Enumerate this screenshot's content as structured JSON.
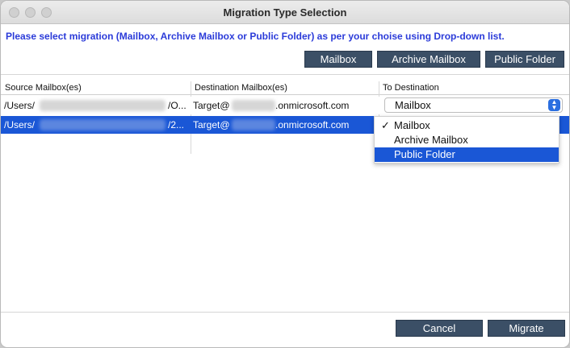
{
  "window": {
    "title": "Migration Type Selection"
  },
  "instruction": "Please select migration (Mailbox, Archive Mailbox or Public Folder) as per your choise using Drop-down list.",
  "toolbar": {
    "mailbox": "Mailbox",
    "archive_mailbox": "Archive Mailbox",
    "public_folder": "Public Folder"
  },
  "table": {
    "columns": [
      "Source Mailbox(es)",
      "Destination Mailbox(es)",
      "To Destination"
    ],
    "rows": [
      {
        "source_start": "/Users/",
        "source_end": "/O...",
        "dest_start": "Target@",
        "dest_end": ".onmicrosoft.com",
        "to": "Mailbox"
      },
      {
        "source_start": "/Users/",
        "source_end": "/2...",
        "dest_start": "Target@",
        "dest_end": ".onmicrosoft.com",
        "to": ""
      }
    ]
  },
  "dropdown": {
    "selected": "Mailbox",
    "check_mark": "✓",
    "options": [
      "Mailbox",
      "Archive Mailbox",
      "Public Folder"
    ]
  },
  "footer": {
    "cancel": "Cancel",
    "migrate": "Migrate"
  },
  "colors": {
    "accent": "#1a57d6",
    "button": "#3b4f66",
    "instruction": "#2b3bd9"
  }
}
